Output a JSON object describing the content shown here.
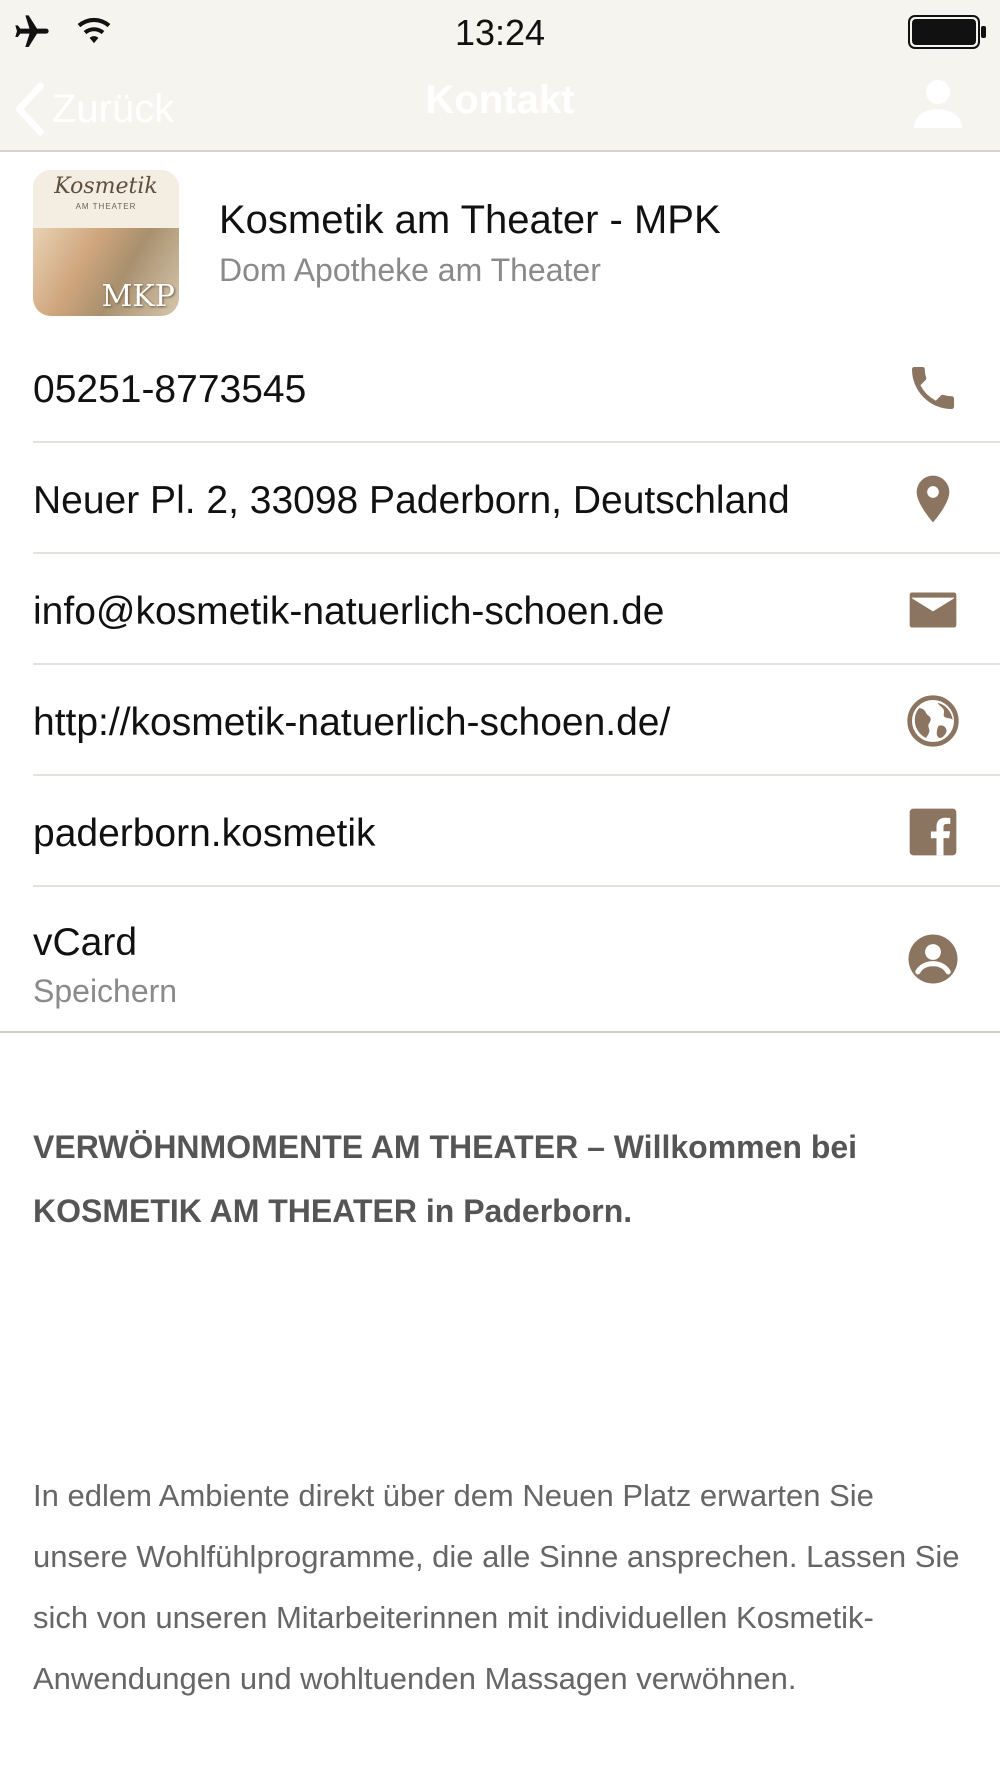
{
  "status_bar": {
    "time": "13:24",
    "icons": [
      "airplane-icon",
      "wifi-icon",
      "battery-icon"
    ]
  },
  "nav": {
    "back_label": "Zurück",
    "title": "Kontakt",
    "profile_icon": "person-icon"
  },
  "header": {
    "title": "Kosmetik am Theater - MPK",
    "subtitle": "Dom Apotheke am Theater",
    "logo": {
      "script_text": "Kosmetik",
      "sub_text": "AM THEATER",
      "corner_text": "MKP"
    }
  },
  "contacts": [
    {
      "label": "05251-8773545",
      "icon": "phone-icon"
    },
    {
      "label": "Neuer Pl. 2, 33098 Paderborn, Deutschland",
      "icon": "location-pin-icon"
    },
    {
      "label": "info@kosmetik-natuerlich-schoen.de",
      "icon": "envelope-icon"
    },
    {
      "label": "http://kosmetik-natuerlich-schoen.de/",
      "icon": "globe-icon"
    },
    {
      "label": "paderborn.kosmetik",
      "icon": "facebook-icon"
    }
  ],
  "vcard": {
    "label": "vCard",
    "sublabel": "Speichern",
    "icon": "account-circle-icon"
  },
  "description": {
    "headline": "VERWÖHNMOMENTE AM THEATER – Willkommen bei KOSMETIK AM THEATER in Paderborn.",
    "body": "In edlem Ambiente direkt über dem Neuen Platz erwarten Sie unsere Wohlfühlprogramme, die alle Sinne ansprechen. Lassen Sie sich von unseren Mitarbeiterinnen mit individuellen Kosmetik-Anwendungen und wohltuenden Massagen verwöhnen."
  },
  "colors": {
    "accent": "#8b7560",
    "bar_background": "#f6f4ef",
    "divider": "#e3e1dd"
  }
}
